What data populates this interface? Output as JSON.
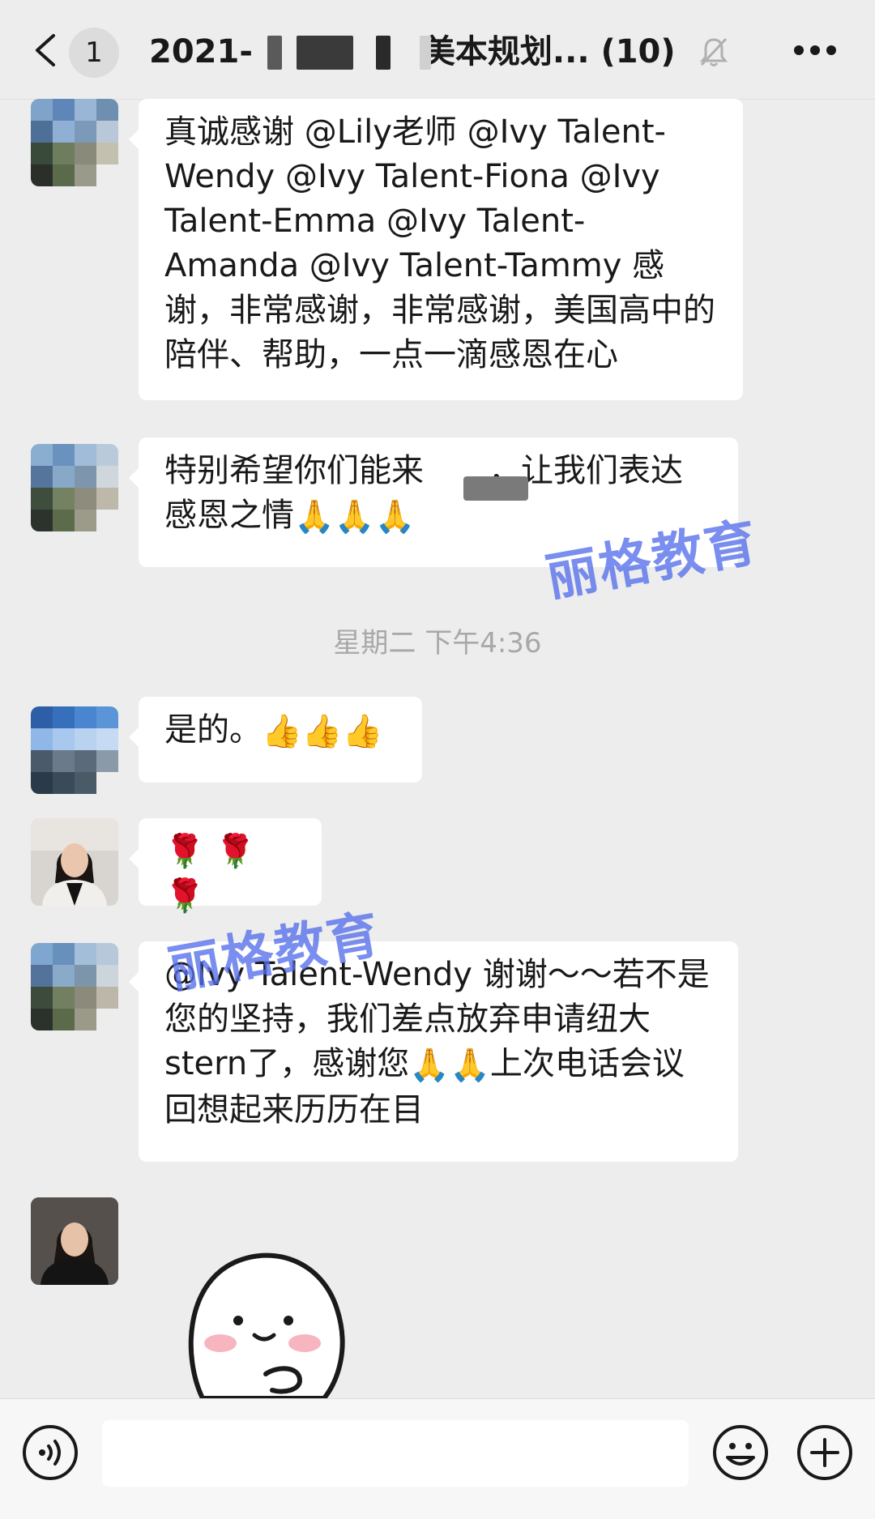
{
  "header": {
    "unread_count": "1",
    "title_prefix": "2021-",
    "title_suffix": "美本规划... (10)"
  },
  "messages": [
    {
      "text": "真诚感谢 @Lily老师 @Ivy Talent-Wendy @Ivy Talent-Fiona @Ivy Talent-Emma @Ivy Talent-Amanda @Ivy Talent-Tammy 感谢，非常感谢，非常感谢，美国高中的陪伴、帮助，一点一滴感恩在心"
    },
    {
      "text_before": "特别希望你们能来",
      "text_after": "，让我们表达感恩之情",
      "emoji": "🙏🙏🙏"
    },
    {
      "text": "是的。",
      "emoji": "👍👍👍"
    },
    {
      "emoji": "🌹 🌹 🌹"
    },
    {
      "text": "@Ivy Talent-Wendy 谢谢～～若不是您的坚持，我们差点放弃申请纽大stern了，感谢您",
      "emoji": "🙏🙏",
      "text_after": "上次电话会议回想起来历历在目"
    }
  ],
  "timestamp": "星期二 下午4:36",
  "watermark": "丽格教育",
  "colors": {
    "background": "#ededed",
    "bubble": "#ffffff",
    "watermark": "#556eeb"
  },
  "icons": [
    "back-icon",
    "mute-icon",
    "more-icon",
    "voice-icon",
    "emoji-icon",
    "plus-icon"
  ]
}
